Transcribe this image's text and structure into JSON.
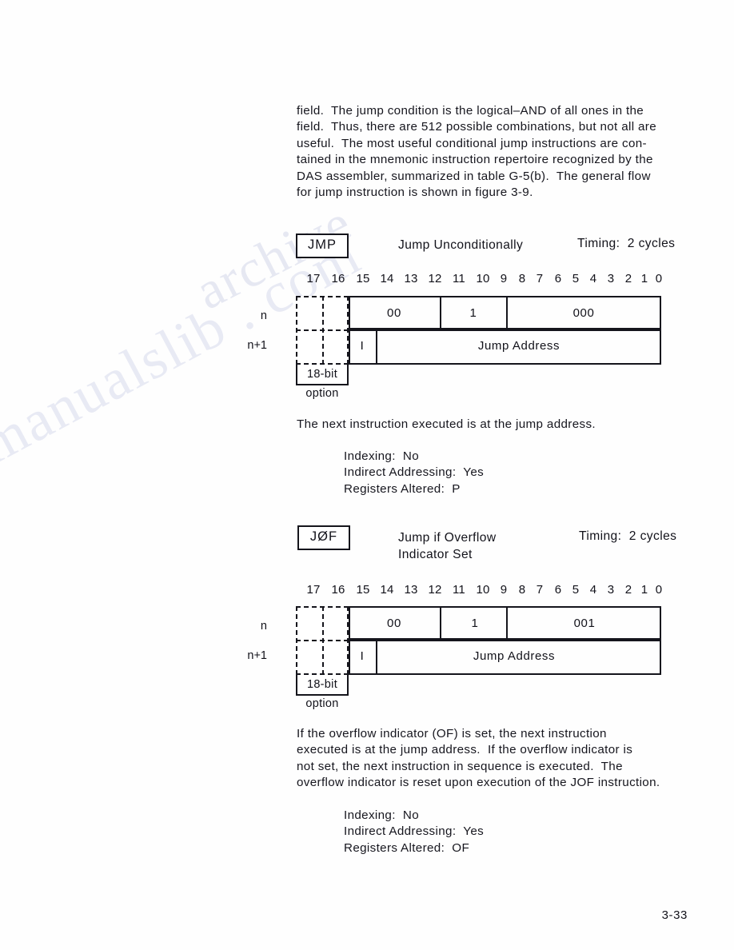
{
  "page": {
    "page_number": "3-33"
  },
  "paragraphs": {
    "intro": "field.  The jump condition is the logical–AND of all ones in the\nfield.  Thus, there are 512 possible combinations, but not all are\nuseful.  The most useful conditional jump instructions are con-\ntained in the mnemonic instruction repertoire recognized by the\nDAS assembler, summarized in table G-5(b).  The general flow\nfor jump instruction is shown in figure 3-9.",
    "jmp_description": "The next instruction executed is at the jump address.",
    "jof_description": "If the overflow indicator (OF) is set, the next instruction\nexecuted is at the jump address.  If the overflow indicator is\nnot set, the next instruction in sequence is executed.  The\noverflow indicator is reset upon execution of the JOF instruction."
  },
  "bit_ruler": {
    "labels": [
      "17",
      "16",
      "15",
      "14",
      "13",
      "12",
      "11",
      "10",
      "9",
      "8",
      "7",
      "6",
      "5",
      "4",
      "3",
      "2",
      "1",
      "0"
    ]
  },
  "instructions": [
    {
      "mnemonic": "JMP",
      "title": "Jump Unconditionally",
      "timing": "Timing:  2 cycles",
      "word_format": {
        "row_labels": [
          "n",
          "n+1"
        ],
        "option_label": "18-bit",
        "option_caption": "option",
        "option_bits": [
          "17",
          "16"
        ],
        "word_n_fields": [
          {
            "label": "00",
            "bits": "15-12"
          },
          {
            "label": "1",
            "bits": "11-9"
          },
          {
            "label": "000",
            "bits": "8-0"
          }
        ],
        "word_n1_fields": [
          {
            "label": "I",
            "bits": "15"
          },
          {
            "label": "Jump Address",
            "bits": "14-0"
          }
        ]
      },
      "attributes": "Indexing:  No\nIndirect Addressing:  Yes\nRegisters Altered:  P"
    },
    {
      "mnemonic": "JØF",
      "title": "Jump if Overflow\nIndicator Set",
      "timing": "Timing:  2 cycles",
      "word_format": {
        "row_labels": [
          "n",
          "n+1"
        ],
        "option_label": "18-bit",
        "option_caption": "option",
        "option_bits": [
          "17",
          "16"
        ],
        "word_n_fields": [
          {
            "label": "00",
            "bits": "15-12"
          },
          {
            "label": "1",
            "bits": "11-9"
          },
          {
            "label": "001",
            "bits": "8-0"
          }
        ],
        "word_n1_fields": [
          {
            "label": "I",
            "bits": "15"
          },
          {
            "label": "Jump Address",
            "bits": "14-0"
          }
        ]
      },
      "attributes": "Indexing:  No\nIndirect Addressing:  Yes\nRegisters Altered:  OF"
    }
  ]
}
